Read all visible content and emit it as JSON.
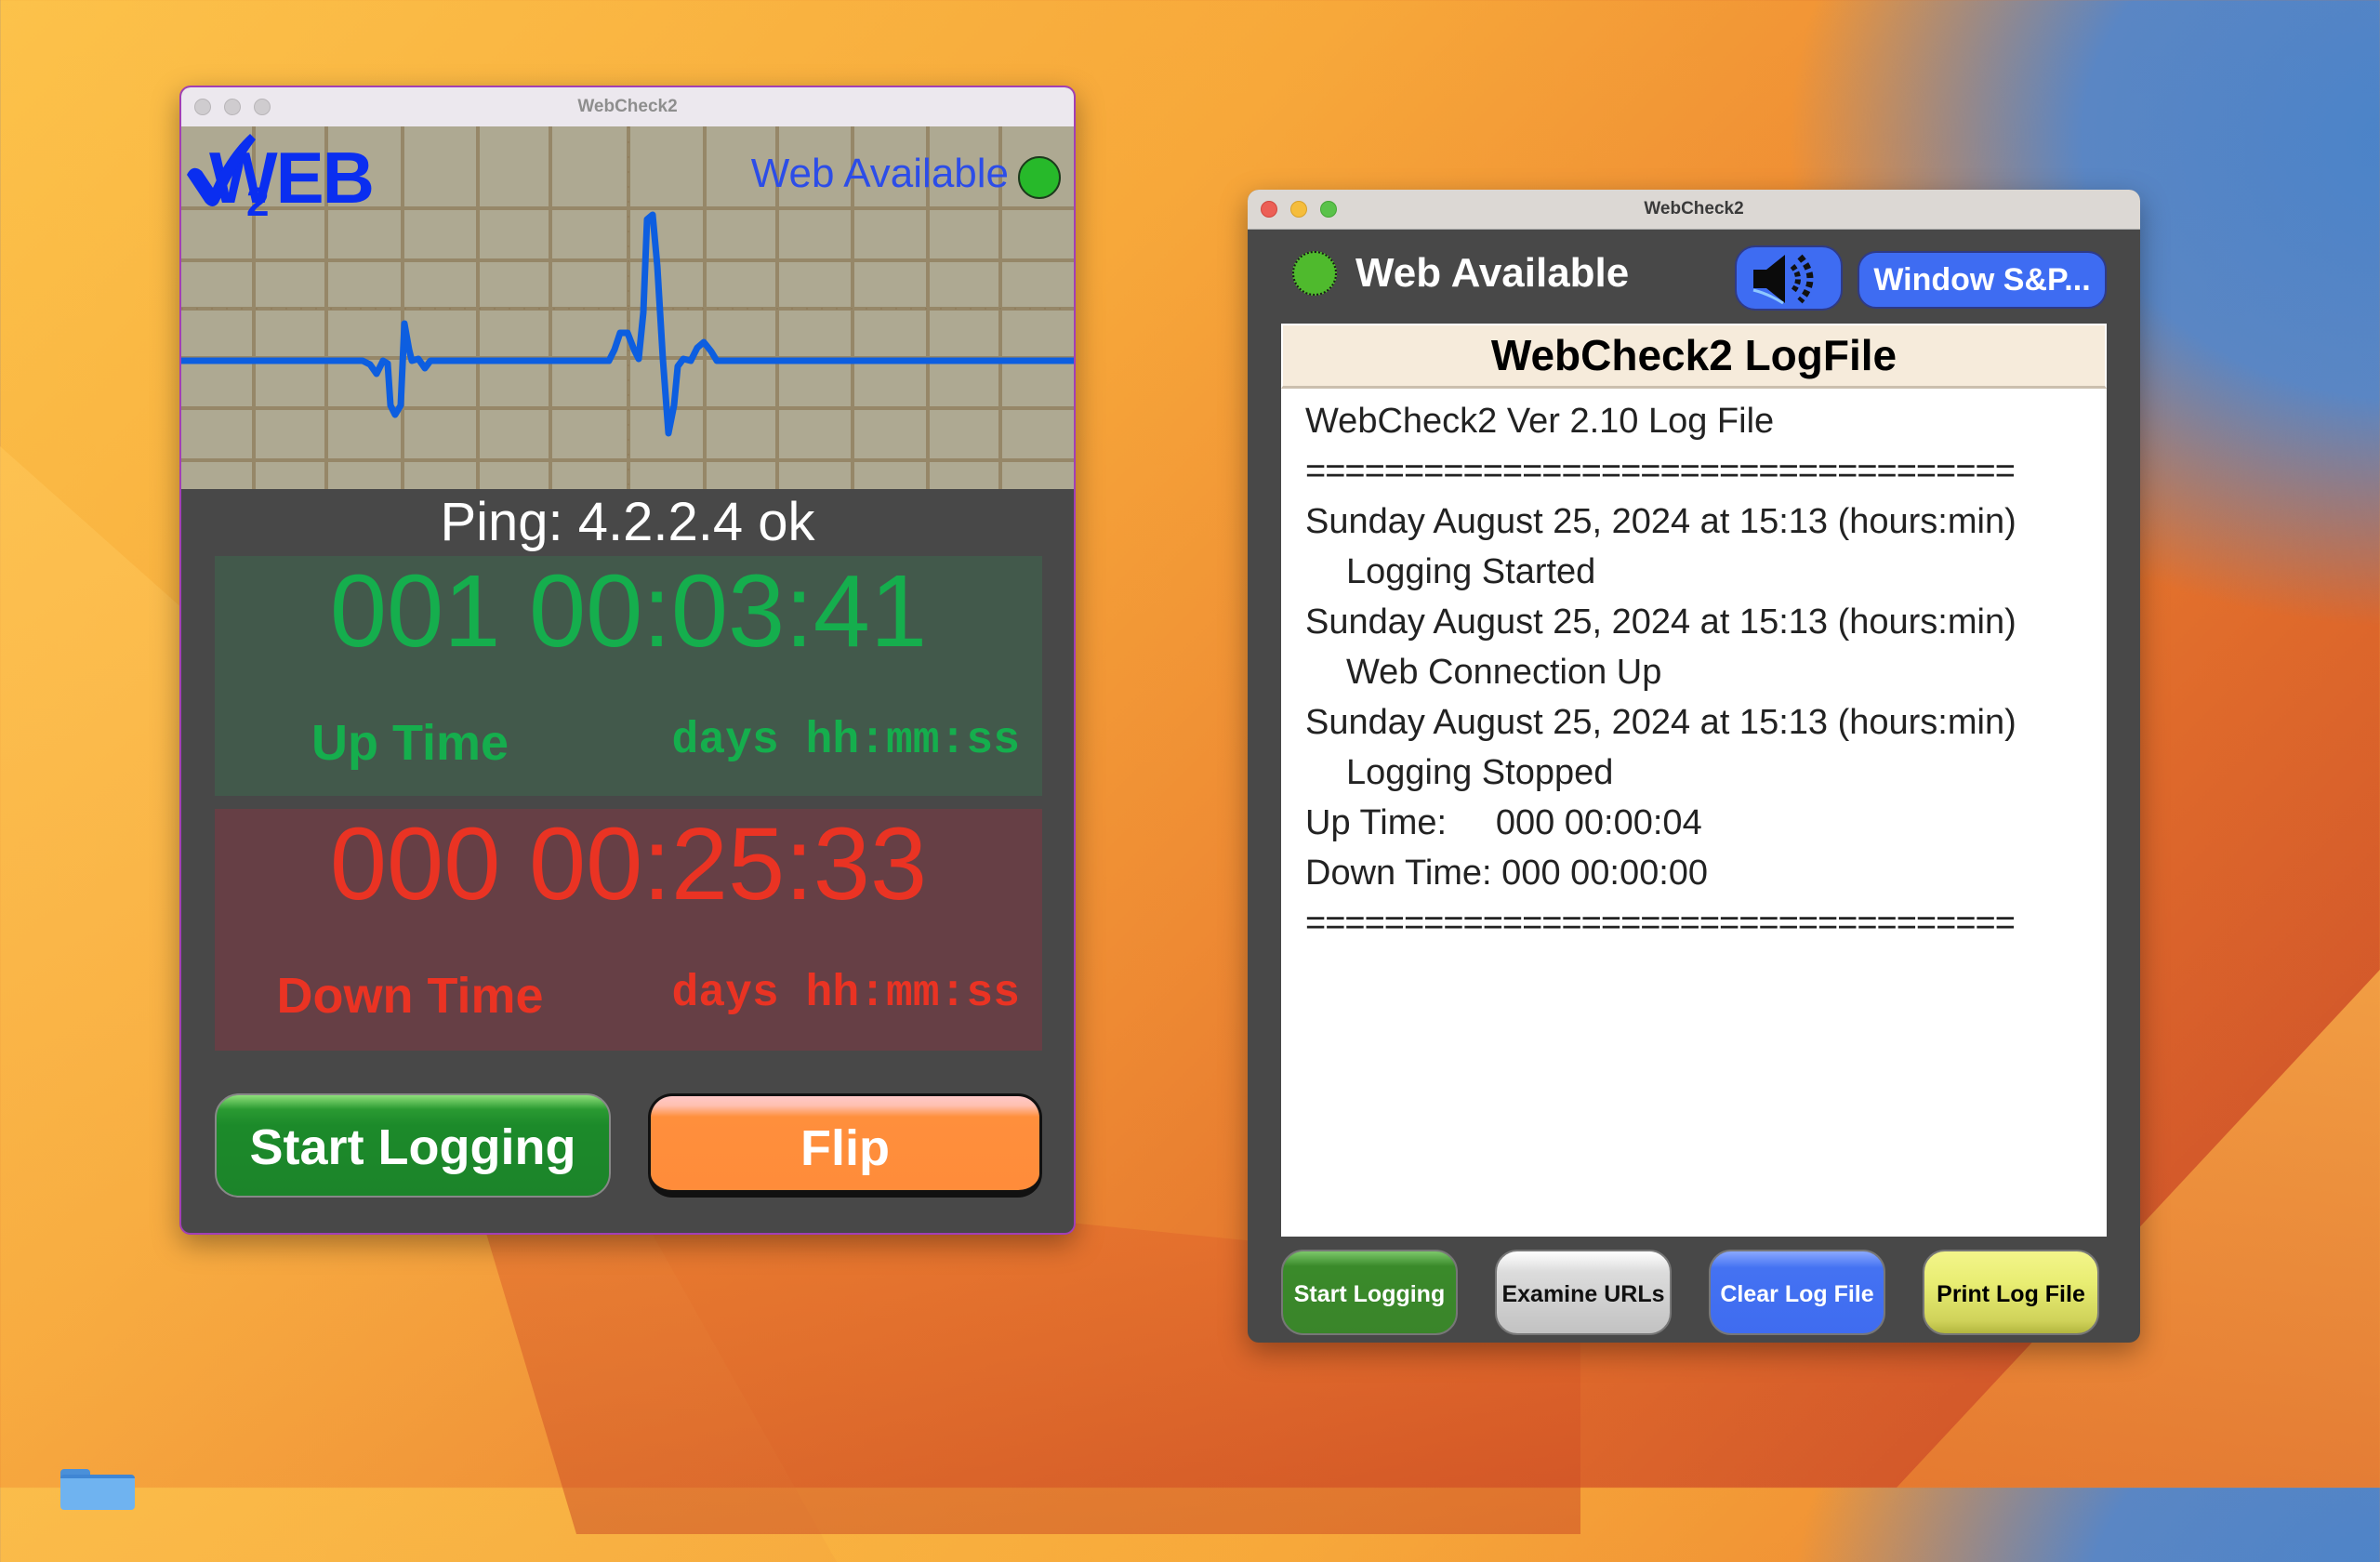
{
  "desktop": {
    "folder_icon": "folder-icon"
  },
  "main_window": {
    "title": "WebCheck2",
    "logo_text": "WEB",
    "logo_check_icon": "checkmark-icon",
    "logo_subscript": "2",
    "status_label": "Web Available",
    "status_color": "#27b92a",
    "ping_text": "Ping: 4.2.2.4 ok",
    "uptime": {
      "value": "001 00:03:41",
      "label": "Up Time",
      "units": "days hh:mm:ss",
      "color": "#15ae4d"
    },
    "downtime": {
      "value": "000 00:25:33",
      "label": "Down Time",
      "units": "days hh:mm:ss",
      "color": "#ea3323"
    },
    "buttons": {
      "start_logging": "Start Logging",
      "flip": "Flip"
    }
  },
  "log_window": {
    "title": "WebCheck2",
    "status_label": "Web Available",
    "status_color": "#4fba2d",
    "speaker_icon": "speaker-icon",
    "window_sp_button": "Window S&P...",
    "log_title": "WebCheck2 LogFile",
    "log_lines": [
      {
        "text": "WebCheck2 Ver 2.10 Log File",
        "type": "normal"
      },
      {
        "text": "====================================",
        "type": "sep"
      },
      {
        "text": "Sunday August 25, 2024 at 15:13 (hours:min)",
        "type": "normal"
      },
      {
        "text": "Logging Started",
        "type": "indent"
      },
      {
        "text": "Sunday August 25, 2024 at 15:13 (hours:min)",
        "type": "normal"
      },
      {
        "text": "Web Connection Up",
        "type": "indent"
      },
      {
        "text": "Sunday August 25, 2024 at 15:13 (hours:min)",
        "type": "normal"
      },
      {
        "text": "Logging Stopped",
        "type": "indent"
      },
      {
        "text": "Up Time:     000 00:00:04",
        "type": "normal"
      },
      {
        "text": "Down Time: 000 00:00:00",
        "type": "normal"
      },
      {
        "text": "====================================",
        "type": "sep"
      }
    ],
    "buttons": {
      "start_logging": "Start Logging",
      "examine_urls": "Examine URLs",
      "clear_log": "Clear Log File",
      "print_log": "Print Log File"
    }
  }
}
